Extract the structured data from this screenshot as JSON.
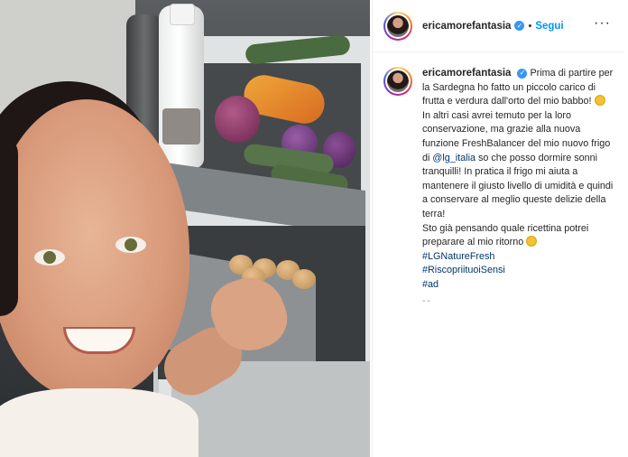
{
  "post": {
    "username": "ericamorefantasia",
    "follow_label": "Segui",
    "more_icon": "···"
  },
  "caption": {
    "username": "ericamorefantasia",
    "line1": "Prima di partire per la Sardegna ho fatto un piccolo carico di frutta e verdura dall'orto del mio babbo!",
    "line2a": "In altri casi avrei temuto per la loro conservazione, ma grazie alla nuova funzione FreshBalancer del mio nuovo frigo di",
    "mention": "@lg_italia",
    "line2b": "so che posso dormire sonni tranquilli! In pratica il frigo mi aiuta a mantenere il giusto livello di umidità e quindi a conservare al meglio queste delizie della terra!",
    "line3": "Sto già pensando quale ricettina potrei preparare al mio ritorno",
    "hashtags": [
      "#LGNatureFresh",
      "#RiscopriituoiSensi",
      "#ad"
    ],
    "ellipsis": "--"
  },
  "colors": {
    "accent": "#0095f6",
    "link": "#00376b",
    "verified": "#3897f0"
  },
  "icons": [
    "verified-badge-icon",
    "more-options-icon",
    "grinning-emoji-icon",
    "yum-emoji-icon"
  ]
}
